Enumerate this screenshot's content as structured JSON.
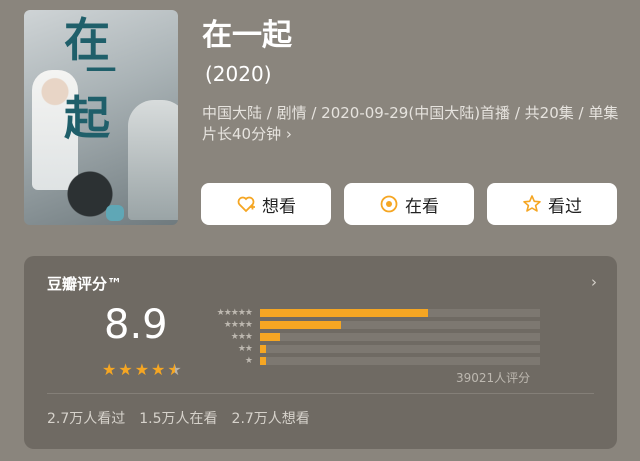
{
  "movie": {
    "title": "在一起",
    "year": "(2020)",
    "meta": "中国大陆 / 剧情 / 2020-09-29(中国大陆)首播 / 共20集 / 单集片长40分钟 ›",
    "poster": {
      "title_glyph_1": "在",
      "title_glyph_2": "一",
      "title_glyph_3": "起"
    }
  },
  "actions": {
    "want_label": "想看",
    "watching_label": "在看",
    "watched_label": "看过"
  },
  "rating": {
    "title": "豆瓣评分™",
    "chevron": "›",
    "score": "8.9",
    "stars_filled": 4.5,
    "count_text": "39021人评分",
    "distribution": [
      {
        "stars": "★★★★★",
        "fraction": 0.6
      },
      {
        "stars": "★★★★",
        "fraction": 0.29
      },
      {
        "stars": "★★★",
        "fraction": 0.07
      },
      {
        "stars": "★★",
        "fraction": 0.02
      },
      {
        "stars": "★",
        "fraction": 0.02
      }
    ]
  },
  "stats": {
    "watched": "2.7万人看过",
    "watching": "1.5万人在看",
    "want": "2.7万人想看"
  },
  "colors": {
    "accent": "#f5a623",
    "background": "#8a857d",
    "panel": "#6f6a63"
  }
}
